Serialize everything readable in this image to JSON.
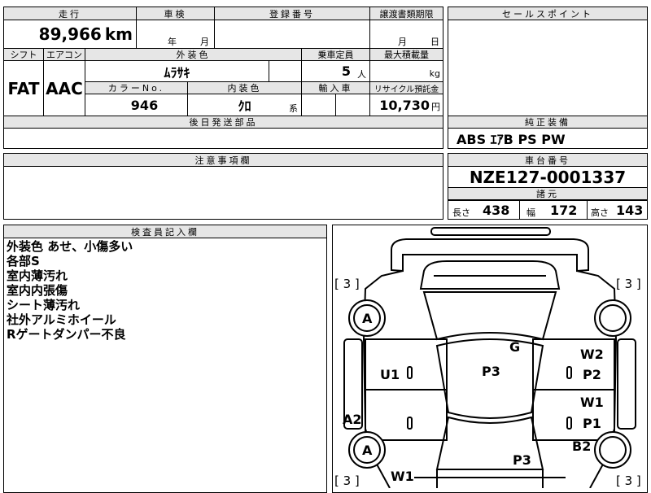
{
  "header": {
    "mileage_label": "走行",
    "inspection_label": "車検",
    "registration_label": "登録番号",
    "transfer_label": "譲渡書類期限",
    "sales_point_label": "セールスポイント"
  },
  "mileage": {
    "value": "89,966",
    "unit": "km"
  },
  "inspection": {
    "year_unit": "年",
    "month_unit": "月"
  },
  "transfer": {
    "month_unit": "月",
    "day_unit": "日"
  },
  "row2": {
    "shift_label": "シフト",
    "aircon_label": "エアコン",
    "exterior_color_label": "外装色",
    "capacity_label": "乗車定員",
    "max_load_label": "最大積載量",
    "shift_value": "FAT",
    "aircon_value": "AAC",
    "exterior_color_value": "ﾑﾗｻｷ",
    "capacity_value": "5",
    "capacity_unit": "人",
    "max_load_unit": "kg",
    "color_no_label": "カラーNo.",
    "interior_color_label": "内装色",
    "import_label": "輸入車",
    "recycle_label": "リサイクル預託金",
    "color_no_value": "946",
    "interior_color_value": "ｸﾛ",
    "interior_color_suffix": "系",
    "recycle_value": "10,730",
    "recycle_unit": "円"
  },
  "later_parts_label": "後日発送部品",
  "equipment": {
    "label": "純正装備",
    "value": "ABS ｴｱB PS PW"
  },
  "caution_label": "注意事項欄",
  "chassis": {
    "label": "車台番号",
    "value": "NZE127-0001337"
  },
  "specs": {
    "label": "諸元",
    "length_label": "長さ",
    "length_value": "438",
    "width_label": "幅",
    "width_value": "172",
    "height_label": "高さ",
    "height_value": "143"
  },
  "inspector": {
    "label": "検査員記入欄",
    "notes": [
      "外装色 あせ、小傷多い",
      "各部S",
      "室内薄汚れ",
      "室内内張傷",
      "シート薄汚れ",
      "社外アルミホイール",
      "Rゲートダンパー不良"
    ]
  },
  "diagram": {
    "tire_left_top": "[ 3 ]",
    "tire_right_top": "[ 3 ]",
    "tire_left_bottom": "[ 3 ]",
    "tire_right_bottom": "[ 3 ]",
    "marks": {
      "a_top": "A",
      "g": "G",
      "w2": "W2",
      "u1": "U1",
      "p3_roof": "P3",
      "p2": "P2",
      "w1_right": "W1",
      "a2": "A2",
      "p1": "P1",
      "a_bottom": "A",
      "b2": "B2",
      "p3_bottom": "P3",
      "w1_bottom": "W1"
    }
  }
}
